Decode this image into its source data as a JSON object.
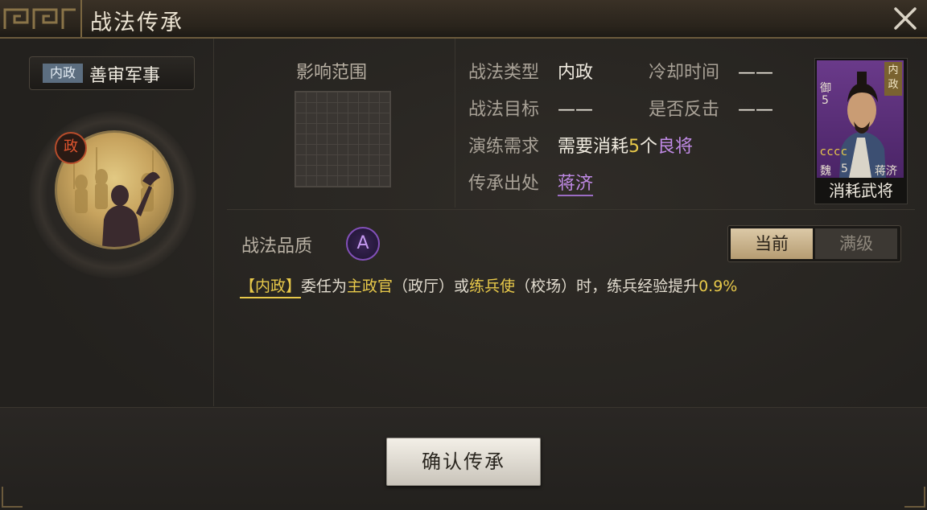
{
  "window": {
    "title": "战法传承"
  },
  "skill": {
    "category": "内政",
    "name": "善审军事",
    "type_badge": "政"
  },
  "range": {
    "label": "影响范围"
  },
  "info": {
    "type_key": "战法类型",
    "type_val": "内政",
    "cooldown_key": "冷却时间",
    "cooldown_val": "——",
    "target_key": "战法目标",
    "target_val": "——",
    "counter_key": "是否反击",
    "counter_val": "——",
    "train_key": "演练需求",
    "train_prefix": "需要消耗",
    "train_count": "5",
    "train_unit": "个",
    "train_quality": "良将",
    "source_key": "传承出处",
    "source_val": "蒋济"
  },
  "card": {
    "type": "内政",
    "troop": "御",
    "level": "5",
    "stars": "cccc",
    "faction": "魏",
    "cost": "5",
    "name": "蒋济",
    "footer": "消耗武将"
  },
  "quality": {
    "label": "战法品质",
    "grade": "A",
    "tab_current": "当前",
    "tab_max": "满级"
  },
  "description": {
    "category": "【内政】",
    "p1": "委任为",
    "role1": "主政官",
    "p2": "（政厅）或",
    "role2": "练兵使",
    "p3": "（校场）时，练兵经验提升",
    "value": "0.9%"
  },
  "buttons": {
    "confirm": "确认传承"
  },
  "colors": {
    "highlight_yellow": "#e8c94a",
    "highlight_purple": "#c08ae6",
    "grade_purple": "#8250b8"
  }
}
